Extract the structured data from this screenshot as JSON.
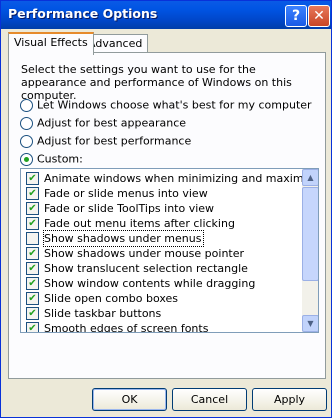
{
  "window": {
    "title": "Performance Options"
  },
  "tabs": [
    {
      "label": "Visual Effects"
    },
    {
      "label": "Advanced"
    }
  ],
  "description": "Select the settings you want to use for the appearance and performance of Windows on this computer.",
  "radios": [
    {
      "label": "Let Windows choose what's best for my computer",
      "selected": false
    },
    {
      "label": "Adjust for best appearance",
      "selected": false
    },
    {
      "label": "Adjust for best performance",
      "selected": false
    },
    {
      "label": "Custom:",
      "selected": true
    }
  ],
  "effects": [
    {
      "label": "Animate windows when minimizing and maximizing",
      "checked": true
    },
    {
      "label": "Fade or slide menus into view",
      "checked": true
    },
    {
      "label": "Fade or slide ToolTips into view",
      "checked": true
    },
    {
      "label": "Fade out menu items after clicking",
      "checked": true
    },
    {
      "label": "Show shadows under menus",
      "checked": false
    },
    {
      "label": "Show shadows under mouse pointer",
      "checked": true
    },
    {
      "label": "Show translucent selection rectangle",
      "checked": true
    },
    {
      "label": "Show window contents while dragging",
      "checked": true
    },
    {
      "label": "Slide open combo boxes",
      "checked": true
    },
    {
      "label": "Slide taskbar buttons",
      "checked": true
    },
    {
      "label": "Smooth edges of screen fonts",
      "checked": true
    }
  ],
  "buttons": {
    "ok": "OK",
    "cancel": "Cancel",
    "apply": "Apply"
  },
  "check_glyph": "✔"
}
